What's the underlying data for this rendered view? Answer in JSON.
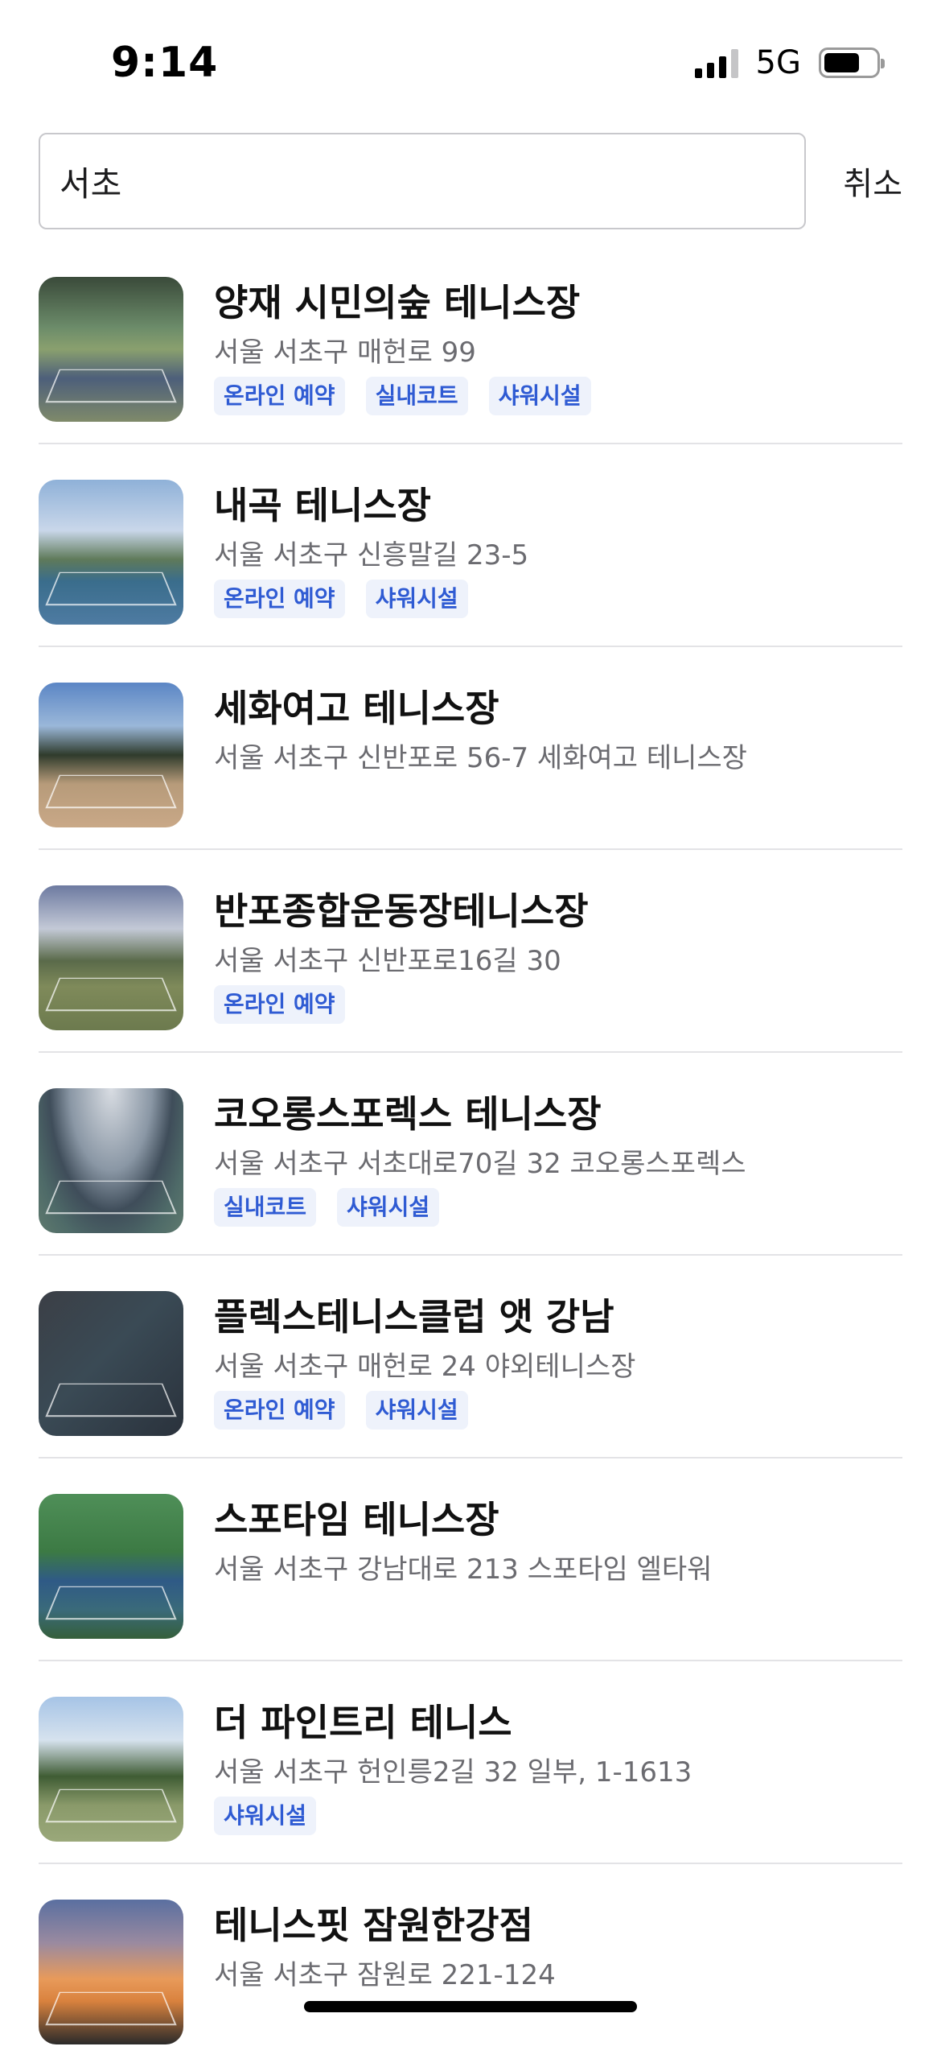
{
  "status_bar": {
    "time": "9:14",
    "network": "5G"
  },
  "search": {
    "value": "서초",
    "cancel_label": "취소"
  },
  "results": [
    {
      "title": "양재 시민의숲 테니스장",
      "address": "서울 서초구 매헌로 99",
      "tags": [
        "온라인 예약",
        "실내코트",
        "샤워시설"
      ]
    },
    {
      "title": "내곡 테니스장",
      "address": "서울 서초구 신흥말길 23-5",
      "tags": [
        "온라인 예약",
        "샤워시설"
      ]
    },
    {
      "title": "세화여고 테니스장",
      "address": "서울 서초구 신반포로 56-7 세화여고 테니스장",
      "tags": []
    },
    {
      "title": "반포종합운동장테니스장",
      "address": "서울 서초구 신반포로16길 30",
      "tags": [
        "온라인 예약"
      ]
    },
    {
      "title": "코오롱스포렉스 테니스장",
      "address": "서울 서초구 서초대로70길 32 코오롱스포렉스",
      "tags": [
        "실내코트",
        "샤워시설"
      ]
    },
    {
      "title": "플렉스테니스클럽 앳 강남",
      "address": "서울 서초구 매헌로 24 야외테니스장",
      "tags": [
        "온라인 예약",
        "샤워시설"
      ]
    },
    {
      "title": "스포타임 테니스장",
      "address": "서울 서초구 강남대로 213 스포타임 엘타워",
      "tags": []
    },
    {
      "title": "더 파인트리 테니스",
      "address": "서울 서초구 헌인릉2길 32 일부, 1-1613",
      "tags": [
        "샤워시설"
      ]
    },
    {
      "title": "테니스핏 잠원한강점",
      "address": "서울 서초구 잠원로 221-124",
      "tags": []
    }
  ],
  "colors": {
    "tag_text": "#2f5bd3",
    "tag_background": "#eef2fb",
    "address_text": "#6b6b70"
  }
}
